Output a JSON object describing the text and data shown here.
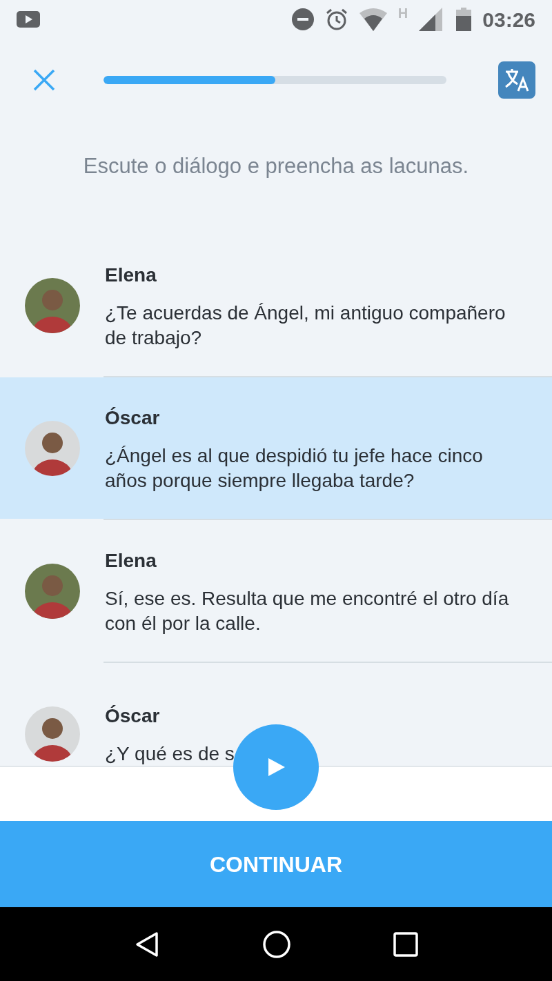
{
  "status_bar": {
    "time": "03:26",
    "network_letter": "H"
  },
  "progress": {
    "level": 0.5
  },
  "instruction": "Escute o diálogo e preencha as lacunas.",
  "dialogue": [
    {
      "speaker": "Elena",
      "text": "¿Te acuerdas de Ángel, mi antiguo compañero de trabajo?",
      "selected": false,
      "color": "#6b7a4e"
    },
    {
      "speaker": "Óscar",
      "text": "¿Ángel es al que despidió tu jefe hace cinco años porque siempre llegaba tarde?",
      "selected": true,
      "color": "#d8dadb"
    },
    {
      "speaker": "Elena",
      "text": "Sí, ese es. Resulta que me encontré el otro día con él por la calle.",
      "selected": false,
      "color": "#6b7a4e"
    },
    {
      "speaker": "Óscar",
      "text": "¿Y qué es de s",
      "selected": false,
      "color": "#d8dadb"
    }
  ],
  "continue_button": "CONTINUAR"
}
